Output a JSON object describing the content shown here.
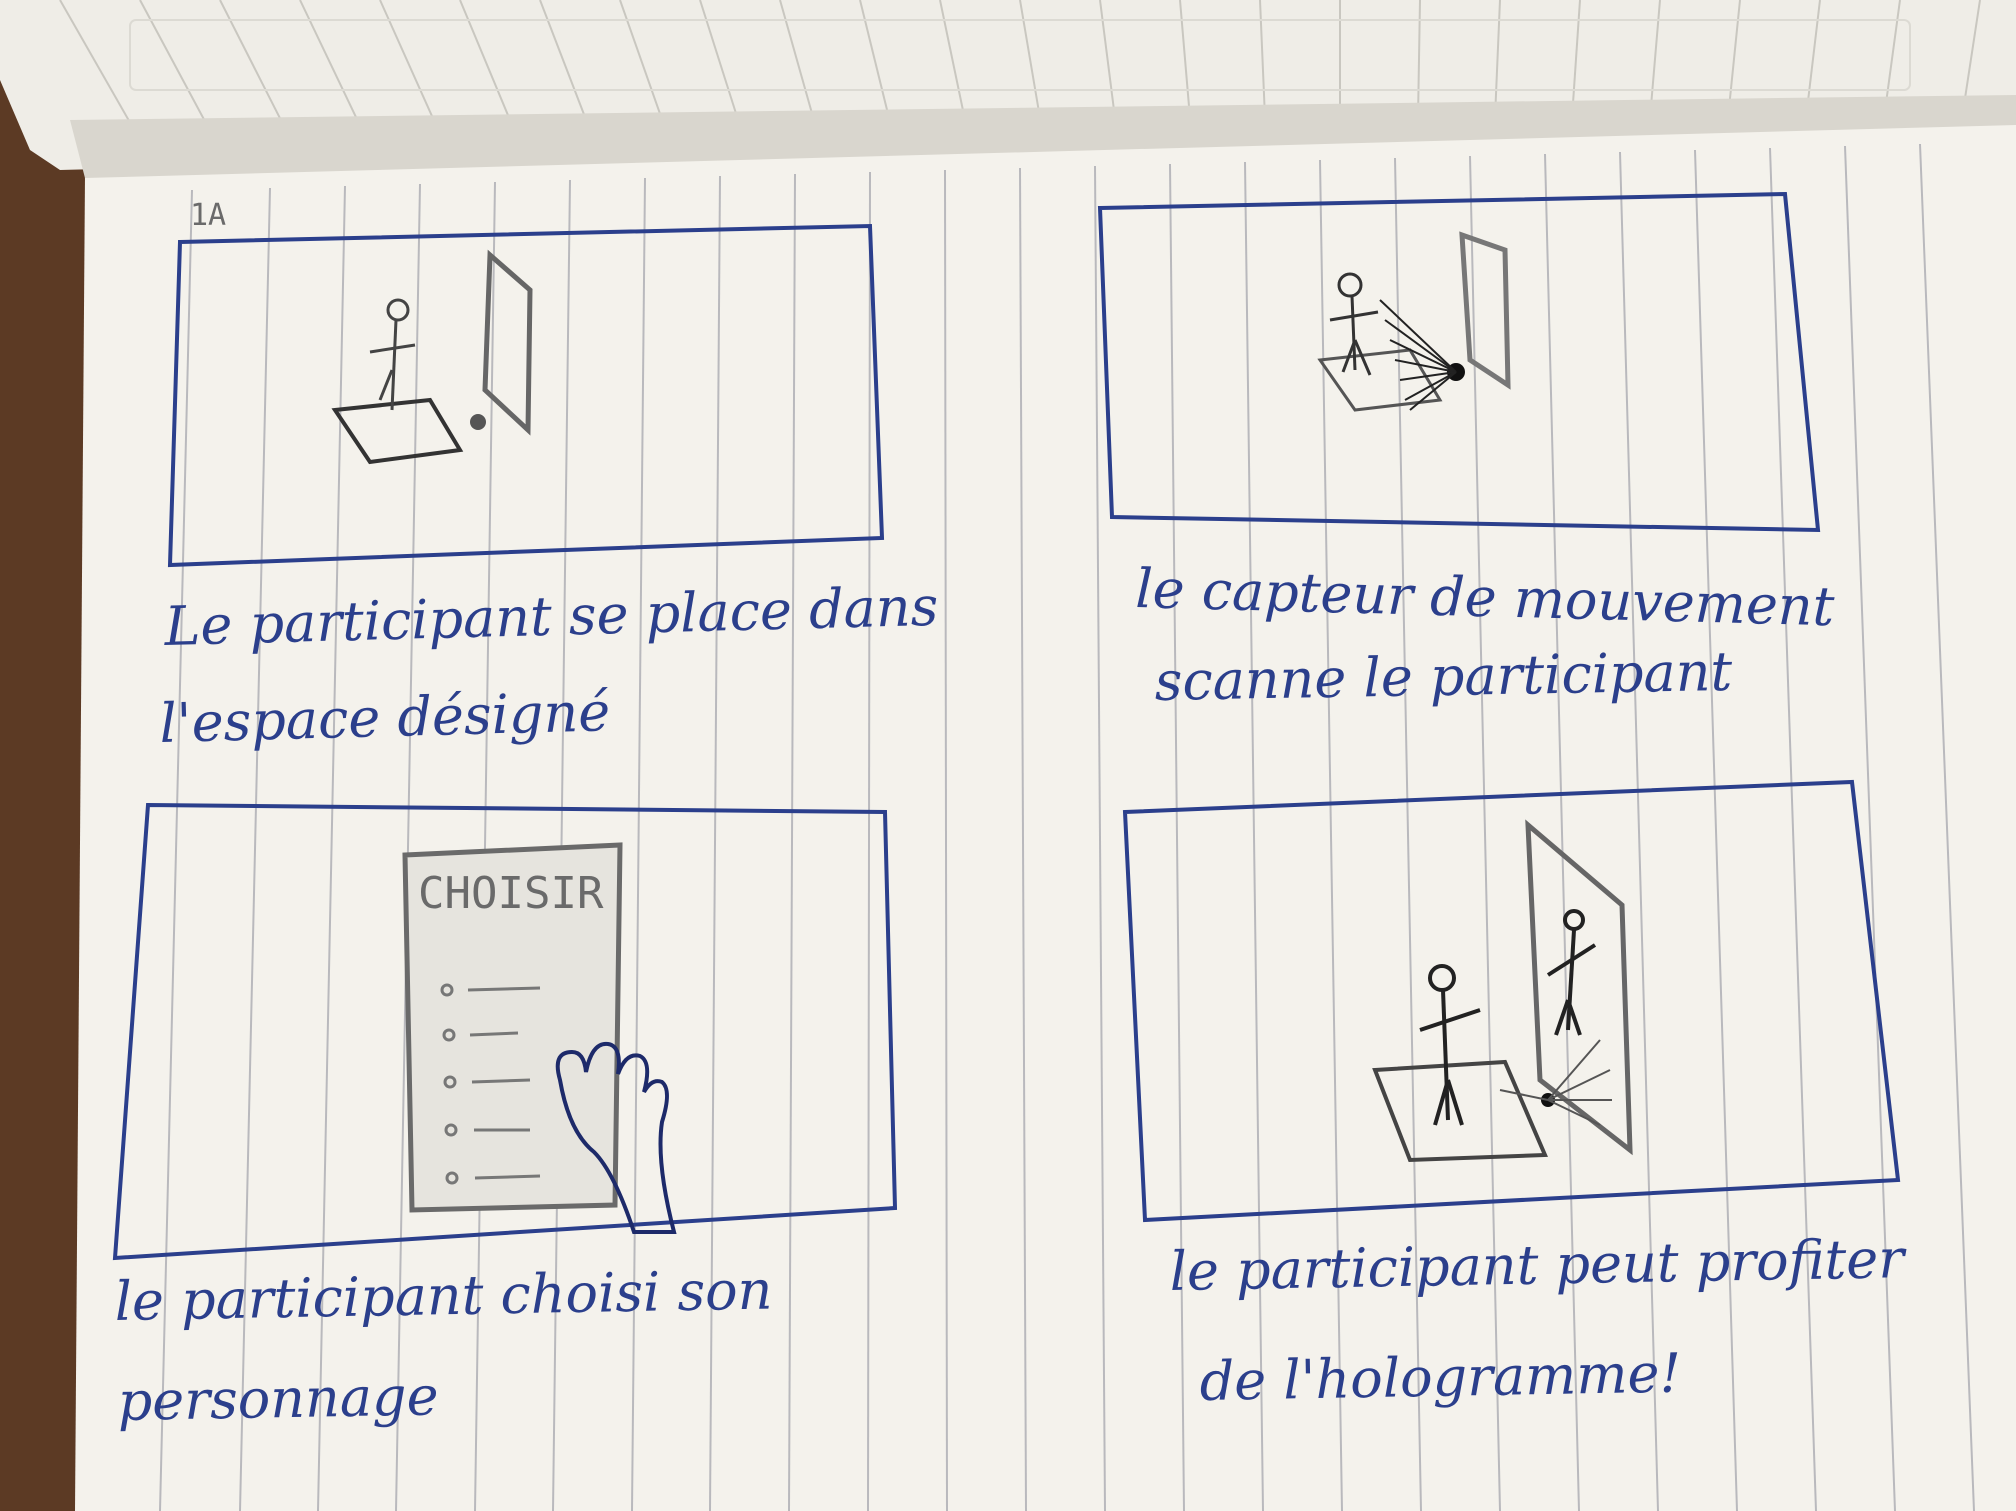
{
  "notebook": {
    "page_label": "1A",
    "ink_color": "#2b3f8c",
    "pencil_color": "#6a6a6a",
    "paper_color": "#f4f2ec",
    "desk_color": "#5c3a24"
  },
  "panels": [
    {
      "scene": "participant standing on floor pad next to hologram display",
      "caption_lines": [
        "Le participant se place dans",
        "l'espace désigné"
      ]
    },
    {
      "scene": "motion sensor scanning participant on floor pad",
      "caption_lines": [
        "le capteur de mouvement",
        "scanne le participant"
      ]
    },
    {
      "scene": "selection menu with hand pointing",
      "menu_title": "CHOISIR",
      "caption_lines": [
        "le participant choisi son",
        "personnage"
      ]
    },
    {
      "scene": "participant facing hologram of themself",
      "caption_lines": [
        "le participant peut profiter",
        "de l'hologramme!"
      ]
    }
  ]
}
